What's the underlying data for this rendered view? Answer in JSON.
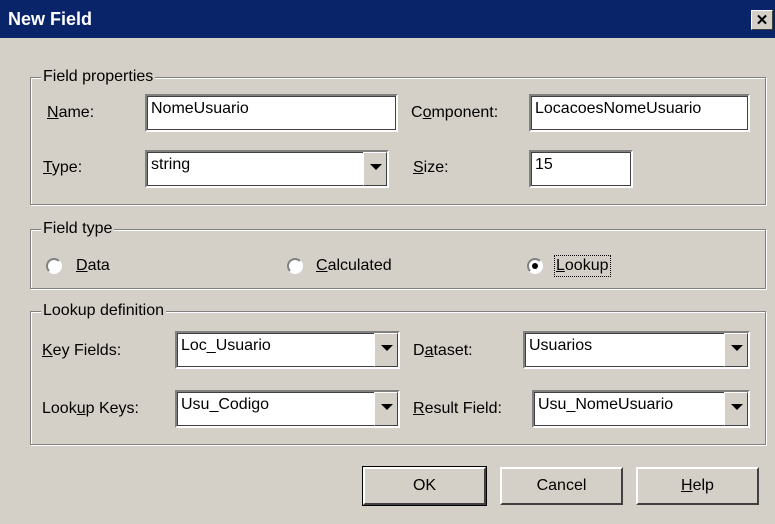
{
  "window": {
    "title": "New Field",
    "close_glyph": "✕"
  },
  "field_properties": {
    "legend": "Field properties",
    "name": {
      "label_accel": "N",
      "label_rest": "ame:",
      "value": "NomeUsuario"
    },
    "component": {
      "label_pre": "C",
      "label_accel": "o",
      "label_rest": "mponent:",
      "value": "LocacoesNomeUsuario"
    },
    "type": {
      "label_accel": "T",
      "label_rest": "ype:",
      "value": "string"
    },
    "size": {
      "label_accel": "S",
      "label_rest": "ize:",
      "value": "15"
    }
  },
  "field_type": {
    "legend": "Field type",
    "options": [
      {
        "accel": "D",
        "rest": "ata",
        "checked": false
      },
      {
        "accel": "C",
        "rest": "alculated",
        "checked": false
      },
      {
        "accel": "L",
        "rest": "ookup",
        "checked": true
      }
    ]
  },
  "lookup_definition": {
    "legend": "Lookup definition",
    "key_fields": {
      "label_accel": "K",
      "label_rest": "ey Fields:",
      "value": "Loc_Usuario"
    },
    "dataset": {
      "label_pre": "D",
      "label_accel": "a",
      "label_rest": "taset:",
      "value": "Usuarios"
    },
    "lookup_keys": {
      "label_pre": "Look",
      "label_accel": "u",
      "label_rest": "p Keys:",
      "value": "Usu_Codigo"
    },
    "result_field": {
      "label_accel": "R",
      "label_rest": "esult Field:",
      "value": "Usu_NomeUsuario"
    }
  },
  "buttons": {
    "ok": "OK",
    "cancel": "Cancel",
    "help_accel": "H",
    "help_rest": "elp"
  },
  "icons": {
    "close": "close-icon",
    "dropdown": "chevron-down-icon"
  },
  "colors": {
    "face": "#d4d0c8",
    "titlebar": "#0a246a",
    "title_text": "#ffffff"
  }
}
